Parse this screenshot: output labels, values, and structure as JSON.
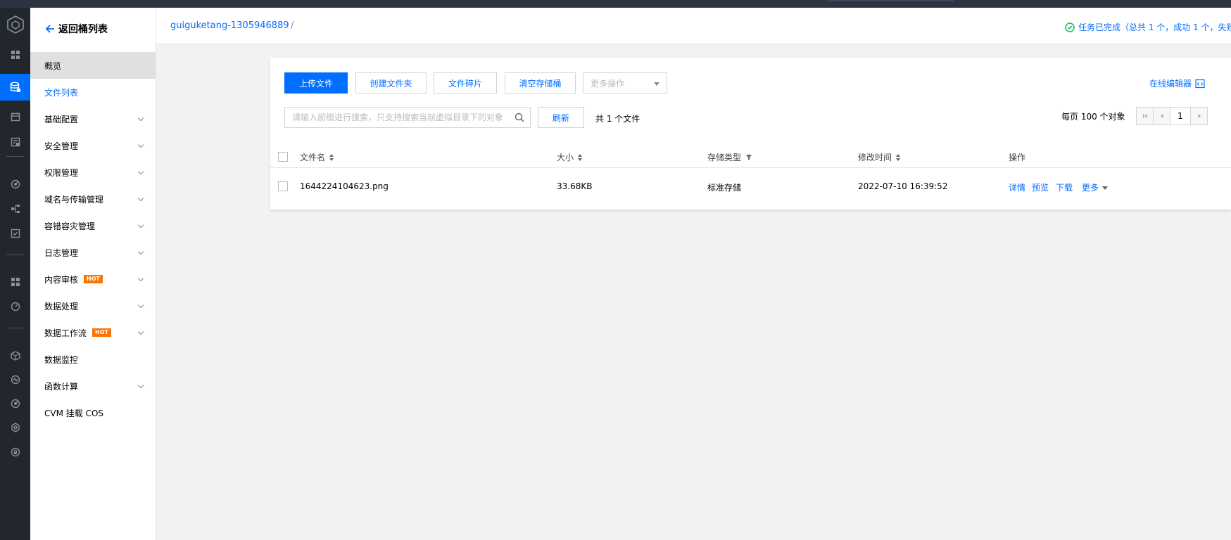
{
  "sidebar": {
    "back_label": "返回桶列表",
    "items": [
      {
        "label": "概览",
        "state": "active",
        "chevron": false
      },
      {
        "label": "文件列表",
        "state": "selected",
        "chevron": false
      },
      {
        "label": "基础配置",
        "chevron": true
      },
      {
        "label": "安全管理",
        "chevron": true
      },
      {
        "label": "权限管理",
        "chevron": true
      },
      {
        "label": "域名与传输管理",
        "chevron": true
      },
      {
        "label": "容错容灾管理",
        "chevron": true
      },
      {
        "label": "日志管理",
        "chevron": true
      },
      {
        "label": "内容审核",
        "badge": "HOT",
        "chevron": true
      },
      {
        "label": "数据处理",
        "chevron": true
      },
      {
        "label": "数据工作流",
        "badge": "HOT",
        "chevron": true
      },
      {
        "label": "数据监控",
        "chevron": false
      },
      {
        "label": "函数计算",
        "chevron": true
      },
      {
        "label": "CVM 挂载 COS",
        "chevron": false
      }
    ]
  },
  "header": {
    "bucket": "guiguketang-1305946889",
    "separator": "/",
    "task_status": "任务已完成（总共 1 个，成功 1 个，失败"
  },
  "toolbar": {
    "upload": "上传文件",
    "create_folder": "创建文件夹",
    "fragments": "文件碎片",
    "clear_bucket": "清空存储桶",
    "more_ops": "更多操作",
    "online_editor": "在线编辑器"
  },
  "search": {
    "placeholder": "请输入前缀进行搜索，只支持搜索当前虚拟目录下的对象",
    "refresh": "刷新",
    "total": "共 1 个文件"
  },
  "pagination": {
    "per_page": "每页 100 个对象",
    "page": "1"
  },
  "table": {
    "columns": {
      "name": "文件名",
      "size": "大小",
      "storage": "存储类型",
      "modified": "修改时间",
      "actions": "操作"
    },
    "rows": [
      {
        "name": "1644224104623.png",
        "size": "33.68KB",
        "storage": "标准存储",
        "modified": "2022-07-10 16:39:52"
      }
    ],
    "row_actions": {
      "detail": "详情",
      "preview": "预览",
      "download": "下载",
      "more": "更多"
    }
  },
  "colors": {
    "accent": "#006eff",
    "rail_bg": "#22272e",
    "hot_badge": "#ff7200",
    "success": "#0abf5b"
  },
  "icons": {
    "rail": [
      "cube-logo-icon",
      "dashboard-icon",
      "database-icon",
      "calendar-icon",
      "storage-check-icon",
      "radar-icon",
      "topology-icon",
      "task-icon",
      "grid-icon",
      "gauge-icon",
      "cube-icon",
      "pulse-icon",
      "radar-icon",
      "settings-icon",
      "lock-icon"
    ]
  }
}
